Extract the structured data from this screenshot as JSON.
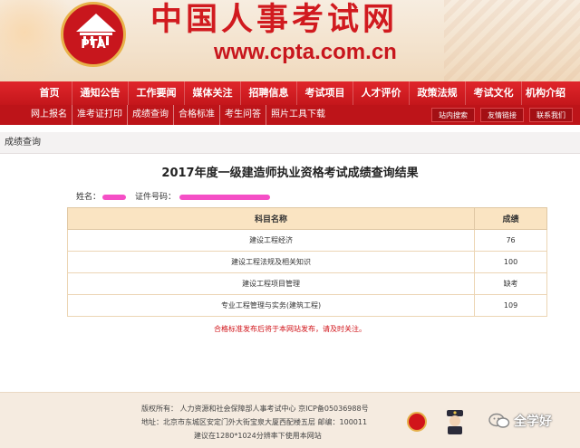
{
  "header": {
    "logo_text": "PTA",
    "site_title": "中国人事考试网",
    "site_url": "www.cpta.com.cn"
  },
  "main_nav": [
    {
      "label": "首页"
    },
    {
      "label": "通知公告"
    },
    {
      "label": "工作要闻"
    },
    {
      "label": "媒体关注"
    },
    {
      "label": "招聘信息"
    },
    {
      "label": "考试项目"
    },
    {
      "label": "人才评价"
    },
    {
      "label": "政策法规"
    },
    {
      "label": "考试文化"
    },
    {
      "label": "机构介绍"
    }
  ],
  "sub_nav": {
    "links": [
      {
        "label": "网上报名"
      },
      {
        "label": "准考证打印"
      },
      {
        "label": "成绩查询"
      },
      {
        "label": "合格标准"
      },
      {
        "label": "考生问答"
      },
      {
        "label": "照片工具下载"
      }
    ],
    "buttons": [
      {
        "label": "站内搜索"
      },
      {
        "label": "友情链接"
      },
      {
        "label": "联系我们"
      }
    ]
  },
  "section": {
    "title": "成绩查询"
  },
  "result": {
    "title": "2017年度一级建造师执业资格考试成绩查询结果",
    "name_label": "姓名：",
    "id_label": "证件号码：",
    "table": {
      "headers": [
        "科目名称",
        "成绩"
      ],
      "rows": [
        {
          "subject": "建设工程经济",
          "score": "76"
        },
        {
          "subject": "建设工程法规及相关知识",
          "score": "100"
        },
        {
          "subject": "建设工程项目管理",
          "score": "缺考"
        },
        {
          "subject": "专业工程管理与实务(建筑工程)",
          "score": "109"
        }
      ]
    },
    "note": "合格标准发布后将于本网站发布，请及时关注。"
  },
  "footer": {
    "copyright": "版权所有：  人力资源和社会保障部人事考试中心  京ICP备05036988号",
    "address": "地址：北京市东城区安定门外大街宝泉大厦西配楼五层  邮编：100011",
    "resolution": "建议在1280*1024分辨率下使用本网站"
  },
  "watermark": {
    "text": "全学好"
  },
  "colors": {
    "brand_red": "#c8161d",
    "nav_red": "#e0262b",
    "table_header": "#fae4c2",
    "note_red": "#d1141a"
  }
}
